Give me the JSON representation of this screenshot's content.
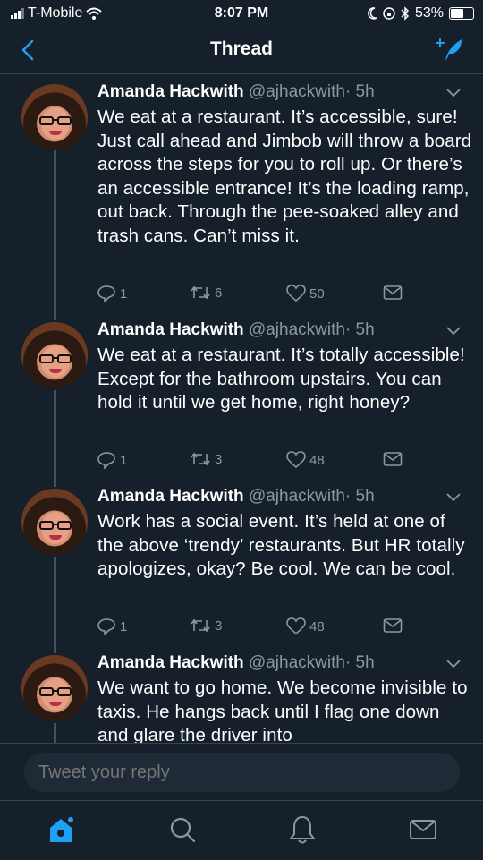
{
  "status": {
    "carrier": "T-Mobile",
    "time": "8:07 PM",
    "battery": "53%",
    "battery_level": 0.53
  },
  "nav": {
    "title": "Thread"
  },
  "tweets": [
    {
      "name": "Amanda Hackwith",
      "handle": "@ajhackwith",
      "time": "· 5h",
      "text": "We eat at a restaurant. It’s accessible, sure! Just call ahead and Jimbob will throw a board across the steps for you to roll up. Or there’s an accessible entrance! It’s the loading ramp, out back. Through the pee-soaked alley and trash cans. Can’t miss it.",
      "replies": "1",
      "retweets": "6",
      "likes": "50"
    },
    {
      "name": "Amanda Hackwith",
      "handle": "@ajhackwith",
      "time": "· 5h",
      "text": "We eat at a restaurant. It’s totally accessible! Except for the bathroom upstairs. You can hold it until we get home, right honey?",
      "replies": "1",
      "retweets": "3",
      "likes": "48"
    },
    {
      "name": "Amanda Hackwith",
      "handle": "@ajhackwith",
      "time": "· 5h",
      "text": "Work has a social event. It’s held at one of the above ‘trendy’ restaurants. But HR totally apologizes, okay? Be cool. We can be cool.",
      "replies": "1",
      "retweets": "3",
      "likes": "48"
    },
    {
      "name": "Amanda Hackwith",
      "handle": "@ajhackwith",
      "time": "· 5h",
      "text": "We want to go home. We become invisible to taxis. He hangs back until I flag one down and glare the driver into"
    }
  ],
  "reply": {
    "placeholder": "Tweet your reply"
  },
  "colors": {
    "background": "#15202b",
    "accent": "#1da1f2",
    "secondary_text": "#8899a6",
    "divider": "#38444d"
  }
}
